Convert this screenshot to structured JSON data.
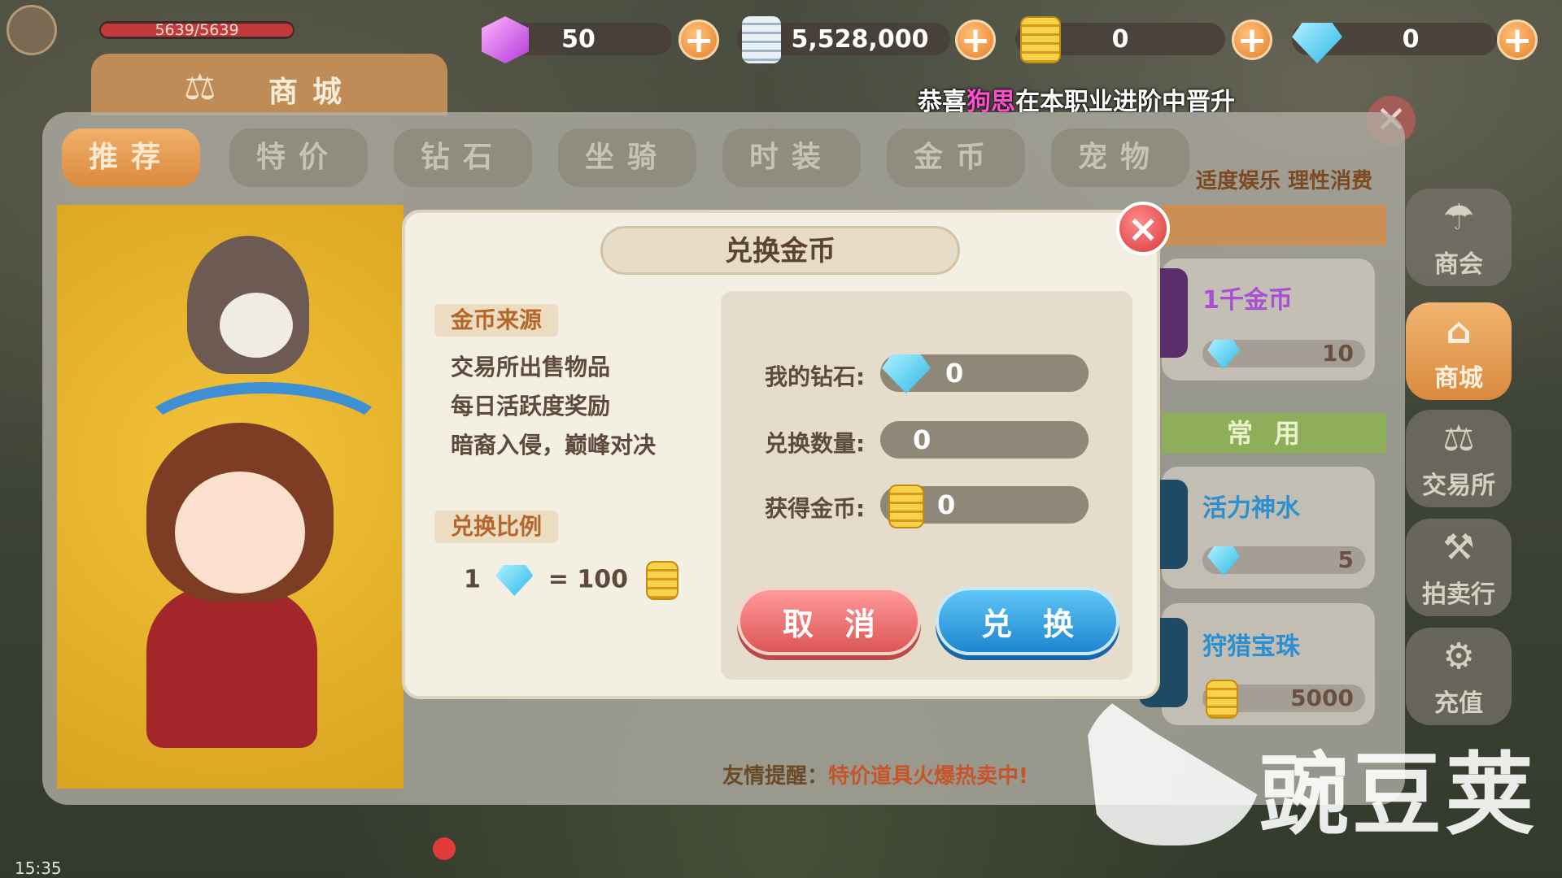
{
  "hud": {
    "hp_text": "5639/5639",
    "hp_fraction": 1.0,
    "purple_gems": "50",
    "silver": "5,528,000",
    "gold": "0",
    "diamonds": "0",
    "plus_symbol": "+"
  },
  "news": {
    "prefix": "恭喜",
    "player": "狗思",
    "suffix": "在本职业进阶中晋升"
  },
  "store": {
    "title": "商城",
    "tabs": [
      "推荐",
      "特价",
      "钻石",
      "坐骑",
      "时装",
      "金币",
      "宠物"
    ],
    "active_tab": 0,
    "slogan": "适度娱乐 理性消费",
    "common_label": "常用",
    "items": [
      {
        "name": "1千金币",
        "price": "10",
        "currency": "diamond-icon",
        "color": "#a84fd3"
      },
      {
        "name": "活力神水",
        "price": "5",
        "currency": "diamond-icon",
        "color": "#2b8fd0"
      },
      {
        "name": "狩猎宝珠",
        "price": "5000",
        "currency": "gold-coin-icon",
        "color": "#2b8fd0"
      }
    ],
    "tip_prefix": "友情提醒：",
    "tip_text": "特价道具火爆热卖中!"
  },
  "sidebar": {
    "items": [
      {
        "label": "商会",
        "icon": "merchant-icon"
      },
      {
        "label": "商城",
        "icon": "shop-icon"
      },
      {
        "label": "交易所",
        "icon": "exchange-icon"
      },
      {
        "label": "拍卖行",
        "icon": "gavel-icon"
      },
      {
        "label": "充值",
        "icon": "recharge-icon"
      }
    ],
    "active": 1
  },
  "dialog": {
    "title": "兑换金币",
    "close_symbol": "×",
    "source_label": "金币来源",
    "sources": [
      "交易所出售物品",
      "每日活跃度奖励",
      "暗裔入侵，巅峰对决"
    ],
    "ratio_label": "兑换比例",
    "ratio_left": "1",
    "ratio_eq": "= 100",
    "my_diamonds_label": "我的钻石:",
    "my_diamonds_value": "0",
    "amount_label": "兑换数量:",
    "amount_value": "0",
    "gain_label": "获得金币:",
    "gain_value": "0",
    "cancel_label": "取消",
    "confirm_label": "兑换"
  },
  "watermark": "豌豆荚",
  "status": {
    "time": "15:35"
  },
  "colors": {
    "accent": "#e3913f",
    "confirm": "#2b97da",
    "cancel": "#e06262"
  }
}
